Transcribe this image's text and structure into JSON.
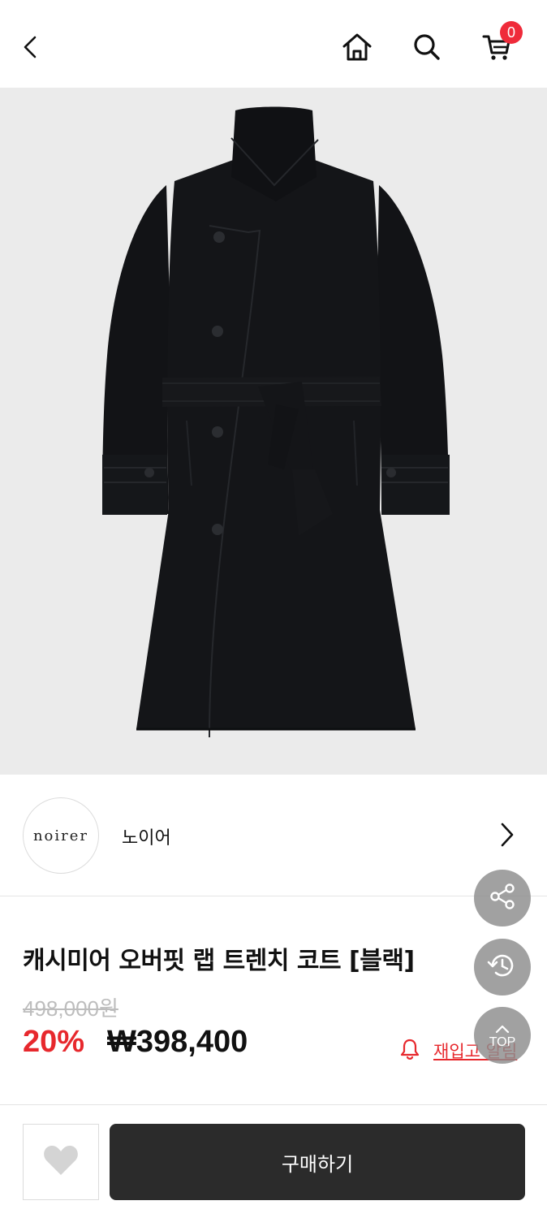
{
  "header": {
    "icons": [
      "back-icon",
      "home-icon",
      "search-icon",
      "cart-icon"
    ],
    "cart_count": "0"
  },
  "product_image": {
    "alt": "black belted wrap coat"
  },
  "brand": {
    "logo_text": "noirer",
    "name": "노이어"
  },
  "product": {
    "title": "캐시미어 오버핏 랩 트렌치 코트 [블랙]",
    "original_price": "498,000원",
    "discount": "20%",
    "sale_price": "₩398,400"
  },
  "restock": {
    "label": "재입고 알림"
  },
  "floating": {
    "top_label": "TOP"
  },
  "bottom_bar": {
    "buy_label": "구매하기"
  },
  "colors": {
    "accent_red": "#e7282d",
    "badge_red": "#ef2b3a",
    "buy_button": "#2b2b2b",
    "image_bg": "#ebebeb",
    "fab_gray": "#8c8c8c"
  }
}
